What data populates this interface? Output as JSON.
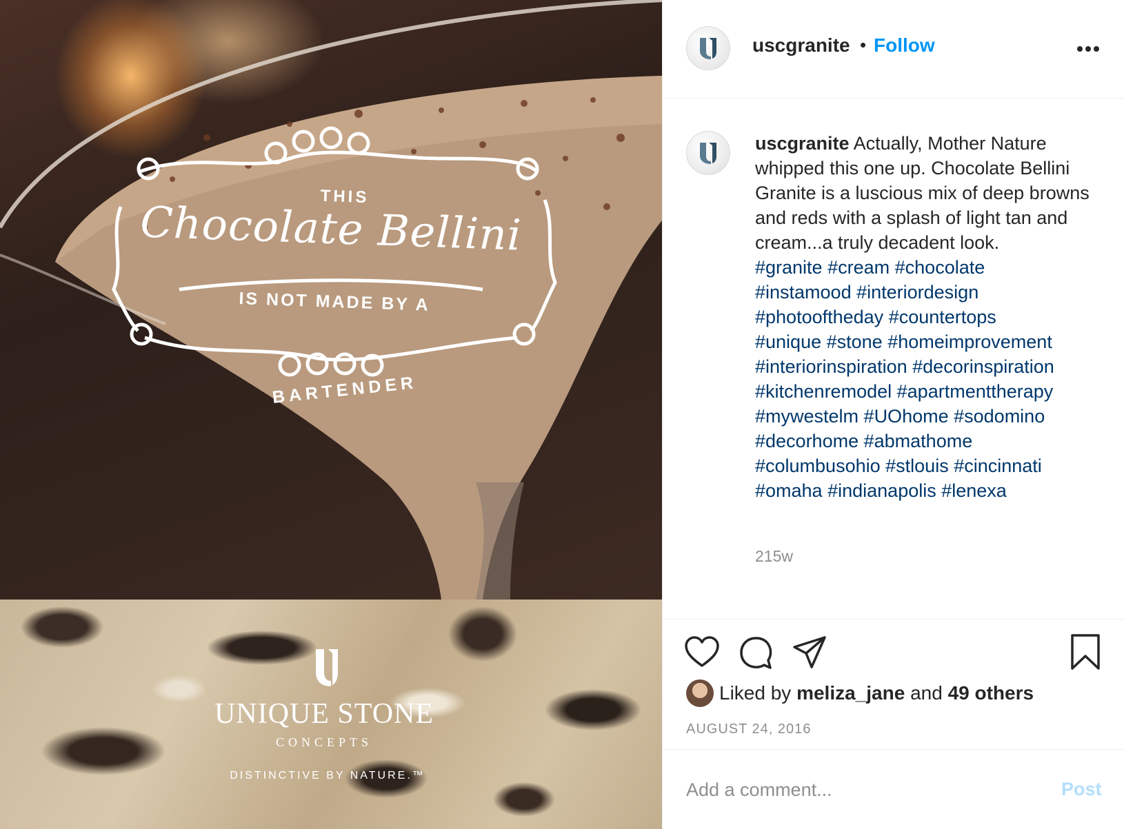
{
  "image": {
    "overlay_this": "THIS",
    "overlay_title": "Chocolate Bellini",
    "overlay_not_made": "IS NOT MADE BY A",
    "overlay_bartender": "BARTENDER",
    "brand_name": "UNIQUE STONE",
    "brand_sub": "CONCEPTS",
    "brand_tagline": "DISTINCTIVE BY NATURE.™"
  },
  "header": {
    "username": "uscgranite",
    "dot": "•",
    "follow_label": "Follow",
    "more_icon": "more-horizontal-icon"
  },
  "caption": {
    "username": "uscgranite",
    "text": "Actually, Mother Nature whipped this one up. Chocolate Bellini Granite is a luscious mix of deep browns and reds with a splash of light tan and cream...a truly decadent look.",
    "hashtag_lines": [
      [
        "#granite",
        "#cream",
        "#chocolate"
      ],
      [
        "#instamood",
        "#interiordesign"
      ],
      [
        "#photooftheday",
        "#countertops"
      ],
      [
        "#unique",
        "#stone",
        "#homeimprovement"
      ],
      [
        "#interiorinspiration",
        "#decorinspiration"
      ],
      [
        "#kitchenremodel",
        "#apartmenttherapy"
      ],
      [
        "#mywestelm",
        "#UOhome",
        "#sodomino"
      ],
      [
        "#decorhome",
        "#abmathome"
      ],
      [
        "#columbusohio",
        "#stlouis",
        "#cincinnati"
      ],
      [
        "#omaha",
        "#indianapolis",
        "#lenexa"
      ]
    ],
    "time_ago": "215w"
  },
  "actions": {
    "icons": [
      "heart-icon",
      "comment-icon",
      "share-icon",
      "bookmark-icon"
    ]
  },
  "likes": {
    "prefix": "Liked by",
    "user": "meliza_jane",
    "and": "and",
    "others": "49 others"
  },
  "date": "AUGUST 24, 2016",
  "comment": {
    "placeholder": "Add a comment...",
    "post_label": "Post"
  },
  "colors": {
    "link_blue": "#0095f6",
    "hashtag": "#00376b",
    "post_disabled": "#b2dffc",
    "muted": "#8e8e8e"
  }
}
